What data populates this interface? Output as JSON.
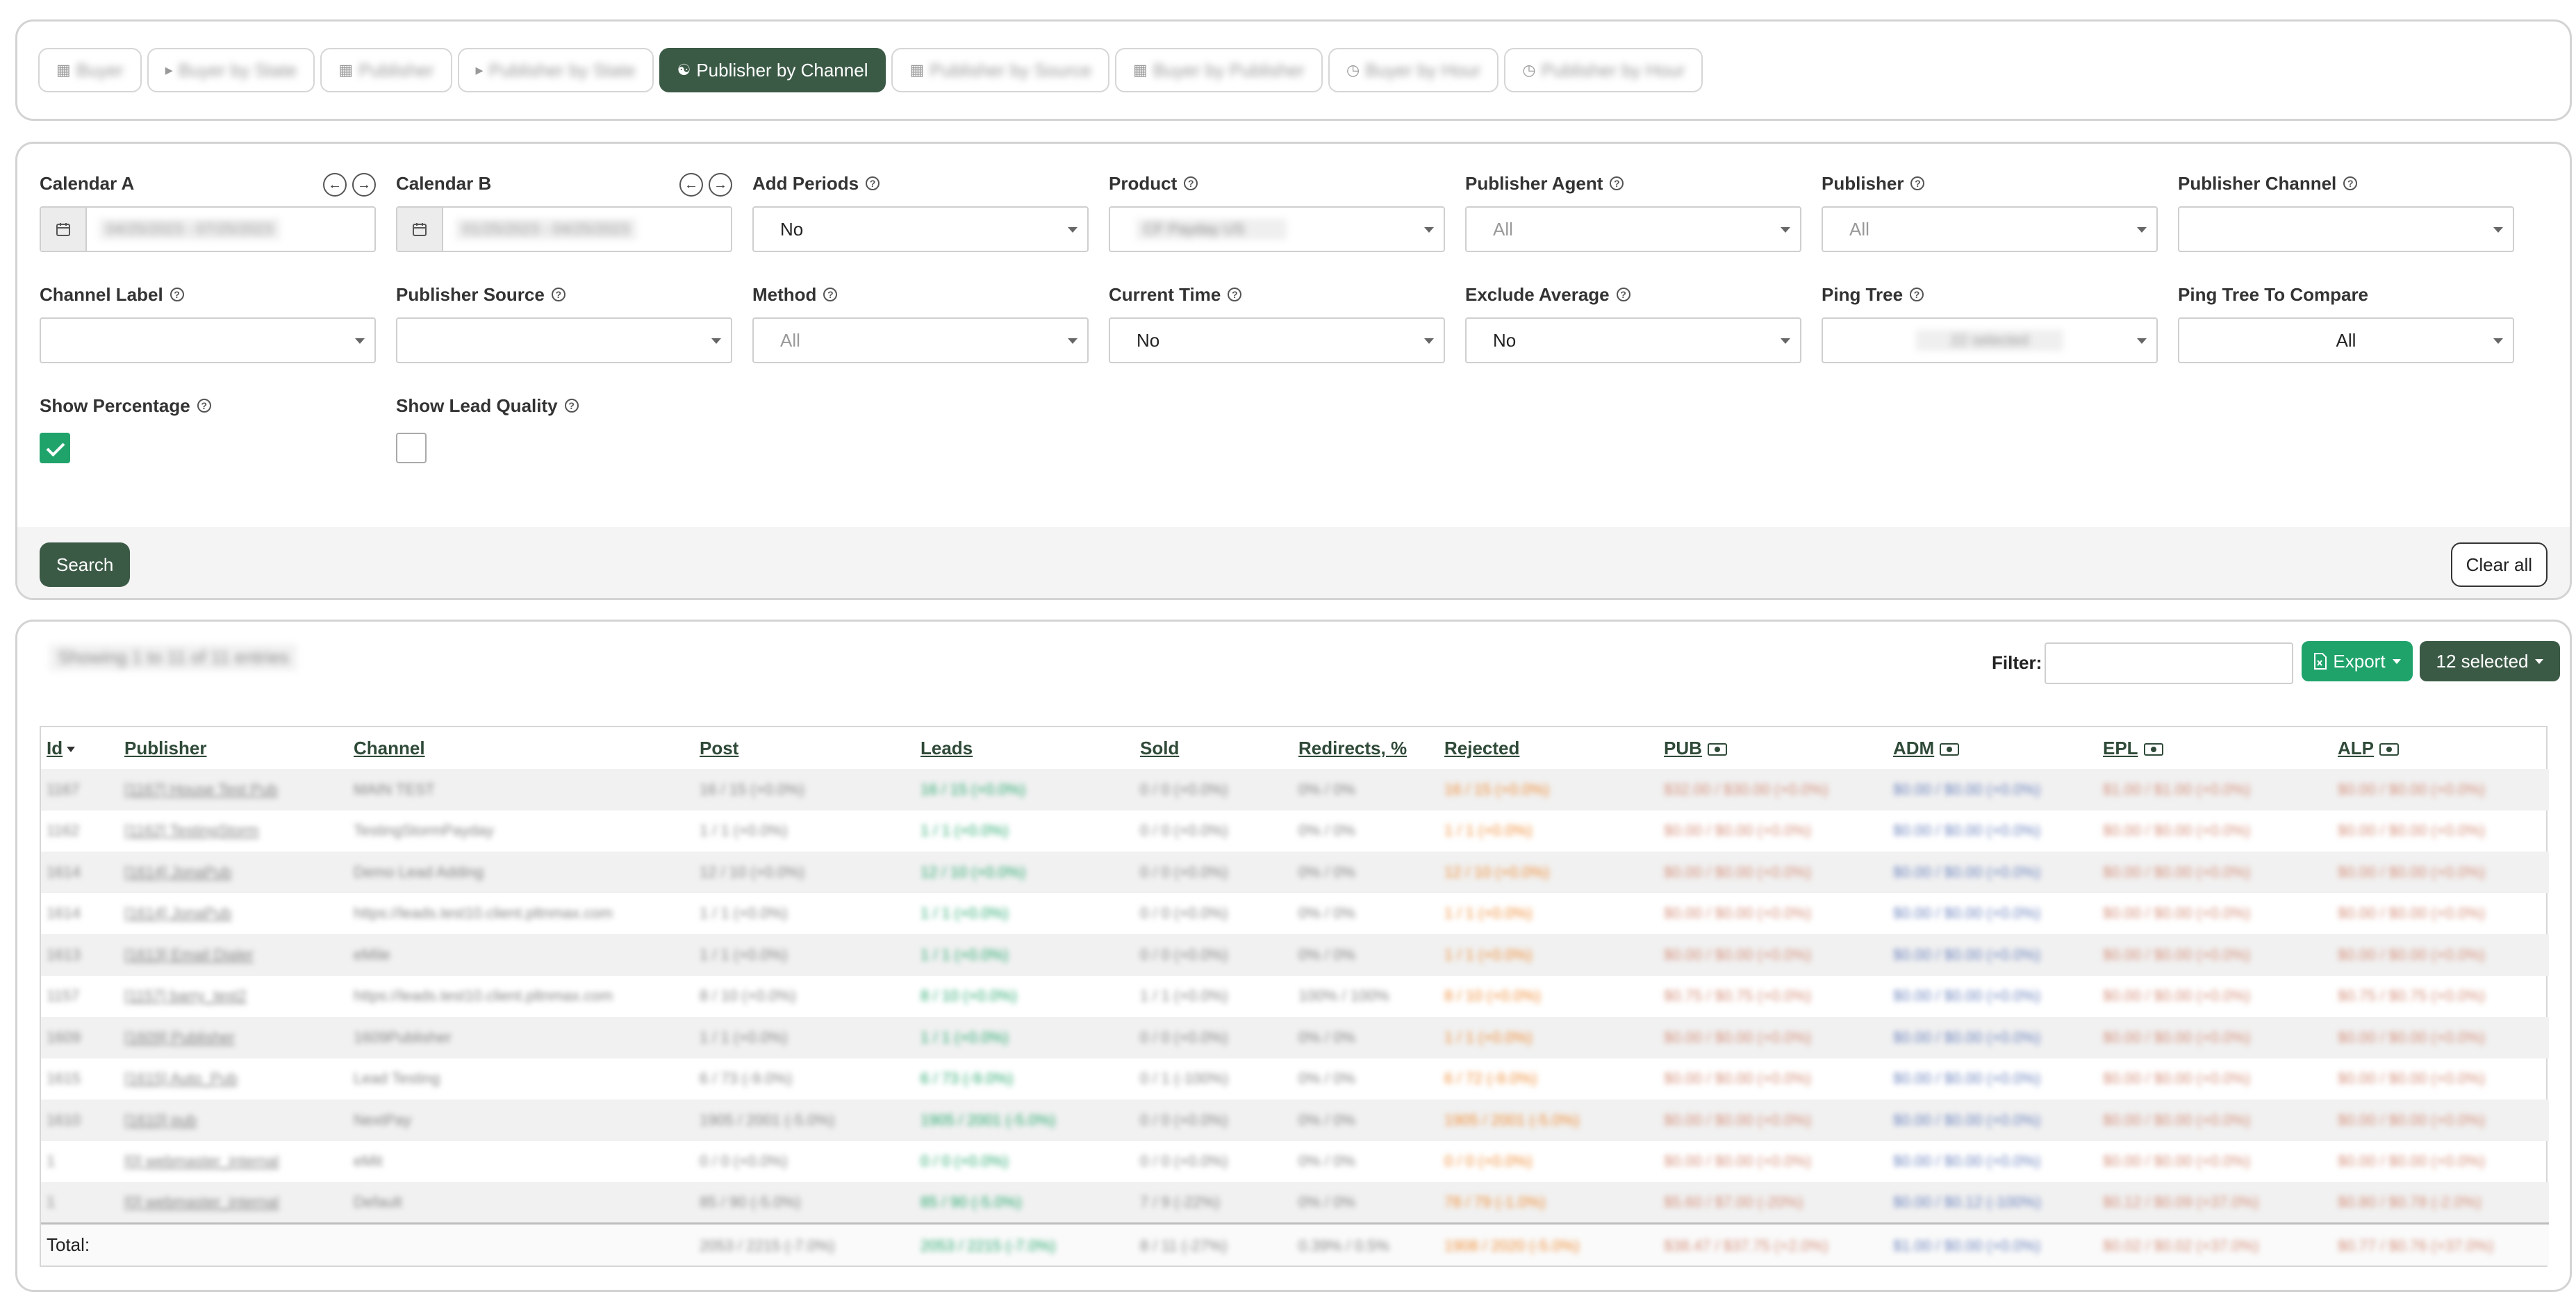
{
  "tabs": [
    {
      "label": "Buyer",
      "active": false
    },
    {
      "label": "Buyer by State",
      "active": false
    },
    {
      "label": "Publisher",
      "active": false
    },
    {
      "label": "Publisher by State",
      "active": false
    },
    {
      "label": "Publisher by Channel",
      "active": true
    },
    {
      "label": "Publisher by Source",
      "active": false
    },
    {
      "label": "Buyer by Publisher",
      "active": false
    },
    {
      "label": "Buyer by Hour",
      "active": false
    },
    {
      "label": "Publisher by Hour",
      "active": false
    }
  ],
  "filters": {
    "calendar_a": {
      "label": "Calendar A",
      "value": "04/25/2023 - 07/25/2023"
    },
    "calendar_b": {
      "label": "Calendar B",
      "value": "01/25/2023 - 04/25/2023"
    },
    "add_periods": {
      "label": "Add Periods",
      "value": "No"
    },
    "product": {
      "label": "Product",
      "value": "CF Payday US"
    },
    "publisher_agent": {
      "label": "Publisher Agent",
      "placeholder": "All"
    },
    "publisher": {
      "label": "Publisher",
      "placeholder": "All"
    },
    "publisher_channel": {
      "label": "Publisher Channel",
      "value": ""
    },
    "channel_label": {
      "label": "Channel Label",
      "value": ""
    },
    "publisher_source": {
      "label": "Publisher Source",
      "value": ""
    },
    "method": {
      "label": "Method",
      "placeholder": "All"
    },
    "current_time": {
      "label": "Current Time",
      "value": "No"
    },
    "exclude_average": {
      "label": "Exclude Average",
      "value": "No"
    },
    "ping_tree": {
      "label": "Ping Tree",
      "value": "22 selected"
    },
    "ping_tree_compare": {
      "label": "Ping Tree To Compare",
      "value": "All"
    },
    "show_percentage": {
      "label": "Show Percentage",
      "checked": true
    },
    "show_lead_quality": {
      "label": "Show Lead Quality",
      "checked": false
    }
  },
  "actions": {
    "search": "Search",
    "clear_all": "Clear all"
  },
  "results": {
    "showing": "Showing 1 to 11 of 11 entries",
    "filter_label": "Filter:",
    "export_label": "Export",
    "selected_label": "12 selected",
    "columns": [
      "Id",
      "Publisher",
      "Channel",
      "Post",
      "Leads",
      "Sold",
      "Redirects, %",
      "Rejected",
      "PUB",
      "ADM",
      "EPL",
      "ALP"
    ],
    "rows": [
      [
        "1167",
        "[1167] House Test Pub",
        "MAIN TEST",
        "16 / 15 (+0.0%)",
        "16 / 15 (+0.0%)",
        "0 / 0 (+0.0%)",
        "0% / 0%",
        "16 / 15 (+0.0%)",
        "$32.00 / $30.00 (+0.0%)",
        "$0.00 / $0.00 (+0.0%)",
        "$1.00 / $1.00 (+0.0%)",
        "$0.00 / $0.00 (+0.0%)"
      ],
      [
        "1162",
        "[1162] TestingStorm",
        "TestingStormPayday",
        "1 / 1 (+0.0%)",
        "1 / 1 (+0.0%)",
        "0 / 0 (+0.0%)",
        "0% / 0%",
        "1 / 1 (+0.0%)",
        "$0.00 / $0.00 (+0.0%)",
        "$0.00 / $0.00 (+0.0%)",
        "$0.00 / $0.00 (+0.0%)",
        "$0.00 / $0.00 (+0.0%)"
      ],
      [
        "1614",
        "[1614] JonaPub",
        "Demo Lead Adding",
        "12 / 10 (+0.0%)",
        "12 / 10 (+0.0%)",
        "0 / 0 (+0.0%)",
        "0% / 0%",
        "12 / 10 (+0.0%)",
        "$0.00 / $0.00 (+0.0%)",
        "$0.00 / $0.00 (+0.0%)",
        "$0.00 / $0.00 (+0.0%)",
        "$0.00 / $0.00 (+0.0%)"
      ],
      [
        "1614",
        "[1614] JonaPub",
        "https://leads.test10.client.pltnmax.com",
        "1 / 1 (+0.0%)",
        "1 / 1 (+0.0%)",
        "0 / 0 (+0.0%)",
        "0% / 0%",
        "1 / 1 (+0.0%)",
        "$0.00 / $0.00 (+0.0%)",
        "$0.00 / $0.00 (+0.0%)",
        "$0.00 / $0.00 (+0.0%)",
        "$0.00 / $0.00 (+0.0%)"
      ],
      [
        "1613",
        "[1613] Email Dialer",
        "eMile",
        "1 / 1 (+0.0%)",
        "1 / 1 (+0.0%)",
        "0 / 0 (+0.0%)",
        "0% / 0%",
        "1 / 1 (+0.0%)",
        "$0.00 / $0.00 (+0.0%)",
        "$0.00 / $0.00 (+0.0%)",
        "$0.00 / $0.00 (+0.0%)",
        "$0.00 / $0.00 (+0.0%)"
      ],
      [
        "1157",
        "[1157] barry_test2",
        "https://leads.test10.client.pltnmax.com",
        "8 / 10 (+0.0%)",
        "8 / 10 (+0.0%)",
        "1 / 1 (+0.0%)",
        "100% / 100%",
        "8 / 10 (+0.0%)",
        "$0.75 / $0.75 (+0.0%)",
        "$0.00 / $0.00 (+0.0%)",
        "$0.00 / $0.00 (+0.0%)",
        "$0.75 / $0.75 (+0.0%)"
      ],
      [
        "1609",
        "[1609] Publisher",
        "1609Publisher",
        "1 / 1 (+0.0%)",
        "1 / 1 (+0.0%)",
        "0 / 0 (+0.0%)",
        "0% / 0%",
        "1 / 1 (+0.0%)",
        "$0.00 / $0.00 (+0.0%)",
        "$0.00 / $0.00 (+0.0%)",
        "$0.00 / $0.00 (+0.0%)",
        "$0.00 / $0.00 (+0.0%)"
      ],
      [
        "1615",
        "[1615] Auto_Pub",
        "Lead Testing",
        "6 / 73 (-9.0%)",
        "6 / 73 (-9.0%)",
        "0 / 1 (-100%)",
        "0% / 0%",
        "6 / 72 (-9.0%)",
        "$0.00 / $0.00 (+0.0%)",
        "$0.00 / $0.00 (+0.0%)",
        "$0.00 / $0.00 (+0.0%)",
        "$0.00 / $0.00 (+0.0%)"
      ],
      [
        "1610",
        "[1610] pub",
        "NextPay",
        "1905 / 2001 (-5.0%)",
        "1905 / 2001 (-5.0%)",
        "0 / 0 (+0.0%)",
        "0% / 0%",
        "1905 / 2001 (-5.0%)",
        "$0.00 / $0.00 (+0.0%)",
        "$0.00 / $0.00 (+0.0%)",
        "$0.00 / $0.00 (+0.0%)",
        "$0.00 / $0.00 (+0.0%)"
      ],
      [
        "1",
        "[0] webmaster_internal",
        "eMit",
        "0 / 0 (+0.0%)",
        "0 / 0 (+0.0%)",
        "0 / 0 (+0.0%)",
        "0% / 0%",
        "0 / 0 (+0.0%)",
        "$0.00 / $0.00 (+0.0%)",
        "$0.00 / $0.00 (+0.0%)",
        "$0.00 / $0.00 (+0.0%)",
        "$0.00 / $0.00 (+0.0%)"
      ],
      [
        "1",
        "[0] webmaster_internal",
        "Default",
        "85 / 90 (-5.0%)",
        "85 / 90 (-5.0%)",
        "7 / 9 (-22%)",
        "0% / 0%",
        "78 / 79 (-1.0%)",
        "$5.60 / $7.00 (-20%)",
        "$0.00 / $0.12 (-100%)",
        "$0.12 / $0.09 (+37.0%)",
        "$0.80 / $0.78 (-2.0%)"
      ]
    ],
    "total_label": "Total:",
    "totals": [
      "2053 / 2215 (-7.0%)",
      "2053 / 2215 (-7.0%)",
      "8 / 11 (-27%)",
      "0.39% / 0.5%",
      "1908 / 2020 (-5.0%)",
      "$38.47 / $37.75 (+2.0%)",
      "$1.00 / $0.00 (+0.0%)",
      "$0.02 / $0.02 (+37.0%)",
      "$0.77 / $0.76 (+37.0%)"
    ]
  }
}
